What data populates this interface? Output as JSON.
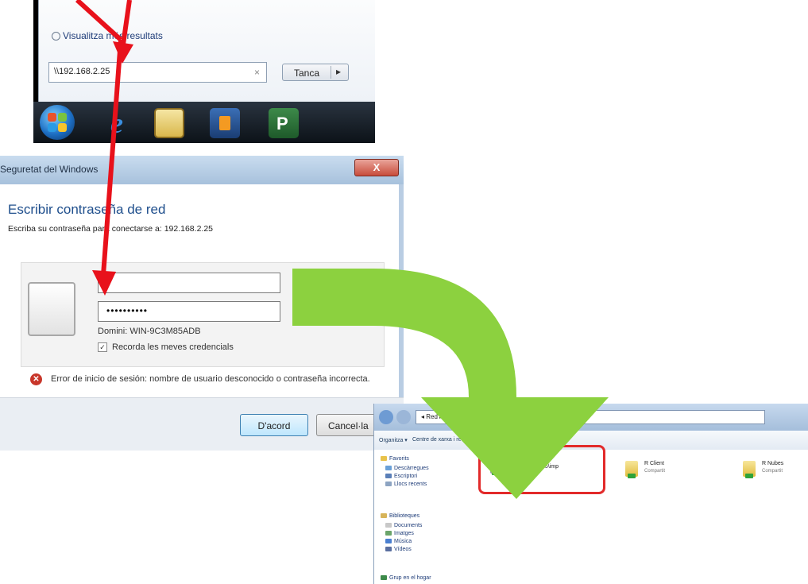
{
  "start_search": {
    "more_results": "Visualitza més resultats",
    "search_value": "\\\\192.168.2.25",
    "clear_glyph": "×",
    "button_label": "Tanca",
    "button_arrow": "▸",
    "taskbar_icons": [
      "windows-orb-icon",
      "internet-explorer-icon",
      "file-explorer-icon",
      "media-player-icon",
      "publisher-icon"
    ],
    "ie_glyph": "e",
    "publisher_glyph": "P"
  },
  "dialog": {
    "title": "Seguretat del Windows",
    "close_glyph": "X",
    "heading": "Escribir contraseña de red",
    "subtitle": "Escriba su contraseña para conectarse a: 192.168.2.25",
    "username_value": "",
    "password_value": "••••••••••",
    "domain": "Domini: WIN-9C3M85ADB",
    "remember_check": "✓",
    "remember_label": "Recorda les meves credencials",
    "error_glyph": "✕",
    "error_text": "Error de inicio de sesión: nombre de usuario desconocido o contraseña incorrecta.",
    "accept_label": "D'acord",
    "cancel_label": "Cancel·la"
  },
  "explorer": {
    "address": "◂ Red ▸ 192.168...",
    "toolbar_items": [
      "Organitza ▾",
      "Centre de xarxa i recursos compartits"
    ],
    "nav_items": [
      {
        "label": "Favorits",
        "color": "#e8c24a"
      },
      {
        "label": "Descàrregues",
        "color": "#6aa0d8"
      },
      {
        "label": "Escriptori",
        "color": "#5a7fb8"
      },
      {
        "label": "Llocs recents",
        "color": "#8da4c2"
      },
      {
        "label": "Biblioteques",
        "color": "#d7b45a"
      },
      {
        "label": "Documents",
        "color": "#c8c8c8"
      },
      {
        "label": "Imatges",
        "color": "#6aa46a"
      },
      {
        "label": "Música",
        "color": "#4a7fd0"
      },
      {
        "label": "Vídeos",
        "color": "#5a6fa0"
      },
      {
        "label": "Grup en el hogar",
        "color": "#3d8a4a"
      }
    ],
    "printer_share": {
      "name": "\\\\192.168.2.25\\imp"
    },
    "shares": [
      {
        "name": "R Client",
        "sub": "Compartit"
      },
      {
        "name": "R Nubes",
        "sub": "Compartit"
      }
    ]
  },
  "annotation_colors": {
    "arrow_red": "#e8111b",
    "arrow_green": "#8cd13f",
    "highlight": "#e22a2a"
  }
}
